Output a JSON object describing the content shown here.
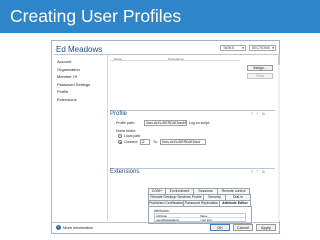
{
  "slide": {
    "title": "Creating User Profiles"
  },
  "header": {
    "user_name": "Ed Meadows",
    "tasks_label": "TASKS",
    "sections_label": "SECTIONS"
  },
  "nav": [
    "Account",
    "Organization",
    "Member Of",
    "Password Settings",
    "Profile",
    "Extensions"
  ],
  "member_of": {
    "col_name": "Name",
    "col_precedence": "Precedence",
    "assign_label": "Assign...",
    "clear_label": "Clear"
  },
  "profile": {
    "title": "Profile",
    "profile_path_label": "Profile path:",
    "profile_path_value": "\\\\lon-dc1\\USERDATA\\ed\\Profile",
    "logon_script_label": "Log on script:",
    "home_folder_label": "Home folder:",
    "local_path_label": "Local path:",
    "connect_label": "Connect:",
    "drive_value": "Z:",
    "to_label": "To:",
    "to_value": "\\\\lon-dc1\\USERDATA\\ed"
  },
  "extensions": {
    "title": "Extensions",
    "tabs_row1": [
      "COM+",
      "Environment",
      "Sessions",
      "Remote control"
    ],
    "tabs_row2": [
      "Remote Desktop Services Profile",
      "Security",
      "Dial-in"
    ],
    "tabs_row3": [
      "Published Certificates",
      "Password Replication",
      "Attribute Editor"
    ],
    "attributes_label": "Attributes:",
    "col_attribute": "Attribute",
    "col_value": "Value",
    "rows": [
      {
        "attribute": "userWorkstations",
        "value": "<not set>"
      },
      {
        "attribute": "whenChanged",
        "value": "<not set>"
      }
    ]
  },
  "footer": {
    "more_info": "More information",
    "ok": "OK",
    "cancel": "Cancel",
    "apply": "Apply"
  },
  "colors": {
    "accent": "#2e86c9",
    "title_text": "#1f4e79",
    "window_border": "#9fb2c6"
  }
}
